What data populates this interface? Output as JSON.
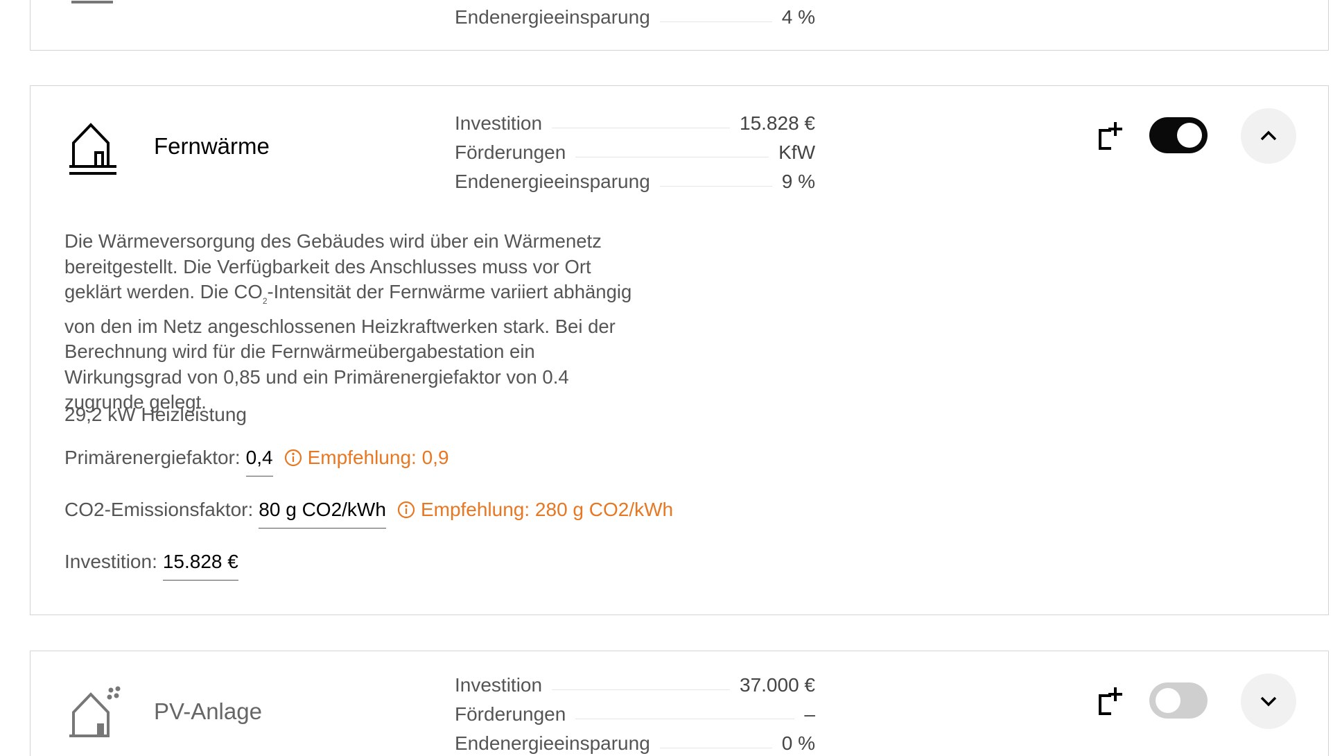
{
  "cards": {
    "top": {
      "metrics": [
        {
          "label": "Endenergieeinsparung",
          "value": "4 %"
        }
      ]
    },
    "fernwaerme": {
      "title": "Fernwärme",
      "metrics": [
        {
          "label": "Investition",
          "value": "15.828 €"
        },
        {
          "label": "Förderungen",
          "value": "KfW"
        },
        {
          "label": "Endenergieeinsparung",
          "value": "9 %"
        }
      ],
      "toggle_state": "on",
      "expanded": true,
      "description": {
        "part1": "Die Wärmeversorgung des Gebäudes wird über ein Wärmenetz bereitgestellt. Die Verfügbarkeit des Anschlusses muss vor Ort geklärt werden. Die CO",
        "sub": "2",
        "part2": "-Intensität der Fernwärme variiert abhängig von den im Netz angeschlossenen Heizkraftwerken stark. Bei der Berechnung wird für die Fernwärmeübergabestation ein Wirkungsgrad von 0,85 und ein Primärenergiefaktor von 0.4 zugrunde gelegt."
      },
      "heat_output": "29,2 kW Heizleistung",
      "fields": {
        "primary_energy": {
          "label": "Primärenergiefaktor:",
          "value": "0,4",
          "hint": "Empfehlung: 0,9"
        },
        "co2": {
          "label": "CO2-Emissionsfaktor:",
          "value": "80 g CO2/kWh",
          "hint": "Empfehlung: 280 g CO2/kWh"
        },
        "investment": {
          "label": "Investition:",
          "value": "15.828 €"
        }
      }
    },
    "pv": {
      "title": "PV-Anlage",
      "metrics": [
        {
          "label": "Investition",
          "value": "37.000 €"
        },
        {
          "label": "Förderungen",
          "value": "–"
        },
        {
          "label": "Endenergieeinsparung",
          "value": "0 %"
        }
      ],
      "toggle_state": "off",
      "expanded": false
    }
  },
  "colors": {
    "accent_hint": "#e87722",
    "toggle_on": "#0a0a0a",
    "toggle_off": "#cfcfcf",
    "border": "#d4d4d4"
  },
  "icons": {
    "fernwaerme": "house-heating-icon",
    "pv": "house-solar-icon",
    "add_to_plan": "add-document-icon",
    "expand": "chevron-up-icon",
    "collapse": "chevron-down-icon",
    "info": "info-circle-icon"
  }
}
